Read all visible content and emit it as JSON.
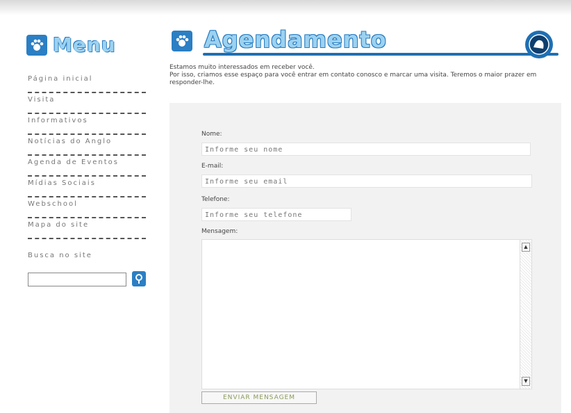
{
  "menu": {
    "title": "Menu",
    "items": [
      {
        "label": "Página inicial"
      },
      {
        "label": "Visita"
      },
      {
        "label": "Informativos"
      },
      {
        "label": "Notícias do Anglo"
      },
      {
        "label": "Agenda de Eventos"
      },
      {
        "label": "Mídias Sociais"
      },
      {
        "label": "Webschool"
      },
      {
        "label": "Mapa do site"
      }
    ],
    "search_label": "Busca no site",
    "search_value": ""
  },
  "header": {
    "title": "Agendamento"
  },
  "intro": {
    "line1": "Estamos muito interessados em receber você.",
    "line2": "Por isso, criamos esse espaço para você entrar em contato conosco e marcar uma visita. Teremos o maior prazer em responder-lhe."
  },
  "form": {
    "name_label": "Nome:",
    "name_placeholder": "Informe seu nome",
    "email_label": "E-mail:",
    "email_placeholder": "Informe seu email",
    "phone_label": "Telefone:",
    "phone_placeholder": "Informe seu telefone",
    "message_label": "Mensagem:",
    "submit_label": "ENVIAR MENSAGEM"
  },
  "colors": {
    "brand_blue": "#2b7fc4",
    "title_light_blue": "#9cd2f0",
    "panel_gray": "#f2f2f2"
  },
  "icons": [
    "paw-icon",
    "search-icon",
    "school-logo-icon"
  ]
}
